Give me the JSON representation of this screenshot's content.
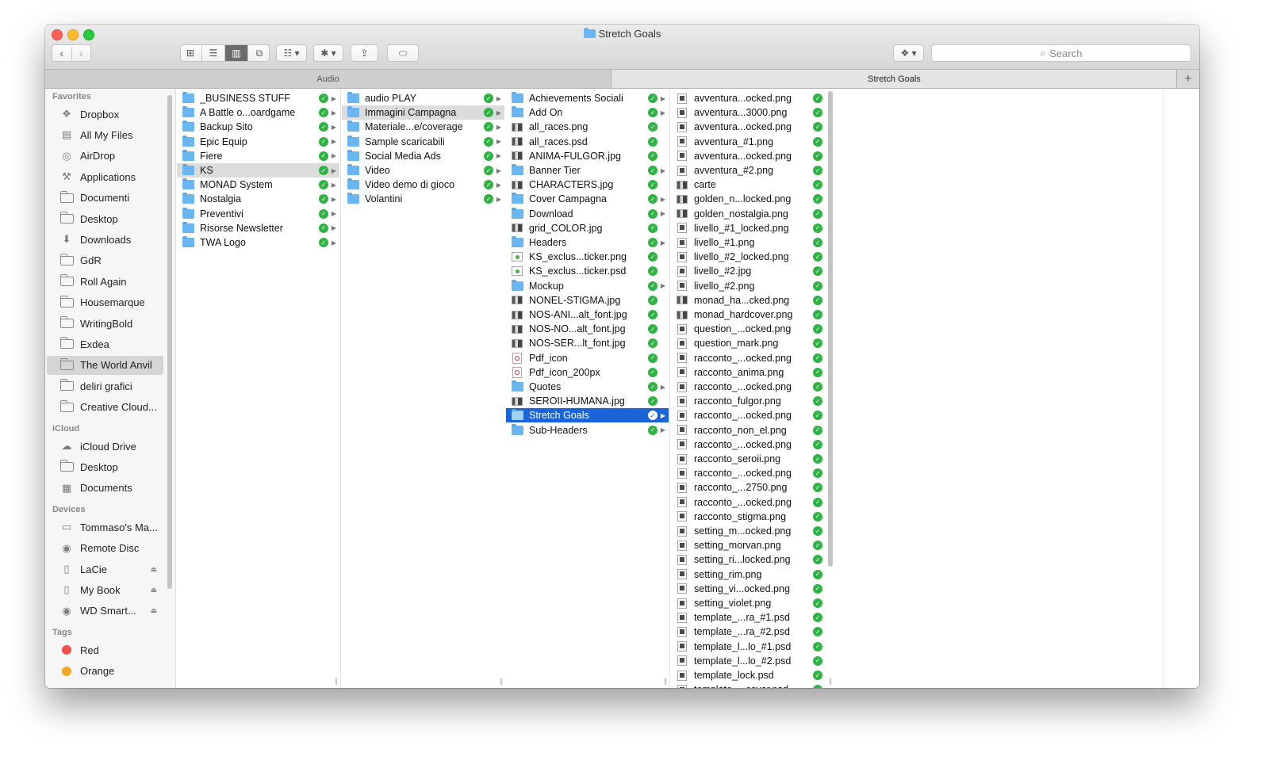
{
  "window": {
    "title": "Stretch Goals"
  },
  "toolbar": {
    "view_icons": [
      "⊞",
      "☰",
      "▥",
      "⧉"
    ],
    "arrange_label": "☷ ▾",
    "action_label": "✱ ▾",
    "share_label": "⇪",
    "tag_label": "⬭",
    "dropbox_label": "❖ ▾",
    "search_placeholder": "Search"
  },
  "tabs": [
    {
      "label": "Audio",
      "active": false
    },
    {
      "label": "Stretch Goals",
      "active": true
    }
  ],
  "sidebar": {
    "favorites_header": "Favorites",
    "favorites": [
      {
        "label": "Dropbox",
        "icon": "dropbox-icon"
      },
      {
        "label": "All My Files",
        "icon": "all-files-icon"
      },
      {
        "label": "AirDrop",
        "icon": "airdrop-icon"
      },
      {
        "label": "Applications",
        "icon": "applications-icon"
      },
      {
        "label": "Documenti",
        "icon": "folder-icon"
      },
      {
        "label": "Desktop",
        "icon": "folder-icon"
      },
      {
        "label": "Downloads",
        "icon": "downloads-icon"
      },
      {
        "label": "GdR",
        "icon": "folder-icon"
      },
      {
        "label": "Roll Again",
        "icon": "folder-icon"
      },
      {
        "label": "Housemarque",
        "icon": "folder-icon"
      },
      {
        "label": "WritingBold",
        "icon": "folder-icon"
      },
      {
        "label": "Exdea",
        "icon": "folder-icon"
      },
      {
        "label": "The World Anvil",
        "icon": "folder-icon",
        "selected": true
      },
      {
        "label": "deliri grafici",
        "icon": "folder-icon"
      },
      {
        "label": "Creative Cloud...",
        "icon": "folder-icon"
      }
    ],
    "icloud_header": "iCloud",
    "icloud": [
      {
        "label": "iCloud Drive",
        "icon": "cloud-icon"
      },
      {
        "label": "Desktop",
        "icon": "folder-icon"
      },
      {
        "label": "Documents",
        "icon": "documents-icon"
      }
    ],
    "devices_header": "Devices",
    "devices": [
      {
        "label": "Tommaso's Ma...",
        "icon": "laptop-icon"
      },
      {
        "label": "Remote Disc",
        "icon": "disc-icon"
      },
      {
        "label": "LaCie",
        "icon": "drive-icon",
        "eject": "⏏"
      },
      {
        "label": "My Book",
        "icon": "drive-icon",
        "eject": "⏏"
      },
      {
        "label": "WD Smart...",
        "icon": "disc-icon",
        "eject": "⏏"
      }
    ],
    "tags_header": "Tags",
    "tags": [
      {
        "label": "Red",
        "color": "#f0504b"
      },
      {
        "label": "Orange",
        "color": "#f5a623"
      }
    ]
  },
  "columns": [
    {
      "items": [
        {
          "name": "_BUSINESS STUFF",
          "type": "folder",
          "arrow": true
        },
        {
          "name": "A Battle o...oardgame",
          "type": "folder",
          "arrow": true
        },
        {
          "name": "Backup Sito",
          "type": "folder",
          "arrow": true
        },
        {
          "name": "Epic Equip",
          "type": "folder",
          "arrow": true
        },
        {
          "name": "Fiere",
          "type": "folder",
          "arrow": true
        },
        {
          "name": "KS",
          "type": "folder",
          "arrow": true,
          "state": "hl"
        },
        {
          "name": "MONAD System",
          "type": "folder",
          "arrow": true
        },
        {
          "name": "Nostalgia",
          "type": "folder",
          "arrow": true
        },
        {
          "name": "Preventivi",
          "type": "folder",
          "arrow": true
        },
        {
          "name": "Risorse Newsletter",
          "type": "folder",
          "arrow": true
        },
        {
          "name": "TWA Logo",
          "type": "folder",
          "arrow": true
        }
      ]
    },
    {
      "items": [
        {
          "name": "audio PLAY",
          "type": "folder",
          "arrow": true
        },
        {
          "name": "Immagini Campagna",
          "type": "folder",
          "arrow": true,
          "state": "hl"
        },
        {
          "name": "Materiale...e/coverage",
          "type": "folder",
          "arrow": true
        },
        {
          "name": "Sample scaricabili",
          "type": "folder",
          "arrow": true
        },
        {
          "name": "Social Media Ads",
          "type": "folder",
          "arrow": true
        },
        {
          "name": "Video",
          "type": "folder",
          "arrow": true
        },
        {
          "name": "Video demo di gioco",
          "type": "folder",
          "arrow": true
        },
        {
          "name": "Volantini",
          "type": "folder",
          "arrow": true
        }
      ]
    },
    {
      "items": [
        {
          "name": "Achievements Sociali",
          "type": "folder",
          "arrow": true
        },
        {
          "name": "Add On",
          "type": "folder",
          "arrow": true
        },
        {
          "name": "all_races.png",
          "type": "img"
        },
        {
          "name": "all_races.psd",
          "type": "img"
        },
        {
          "name": "ANIMA-FULGOR.jpg",
          "type": "img"
        },
        {
          "name": "Banner Tier",
          "type": "folder",
          "arrow": true
        },
        {
          "name": "CHARACTERS.jpg",
          "type": "img"
        },
        {
          "name": "Cover Campagna",
          "type": "folder",
          "arrow": true
        },
        {
          "name": "Download",
          "type": "folder",
          "arrow": true
        },
        {
          "name": "grid_COLOR.jpg",
          "type": "img"
        },
        {
          "name": "Headers",
          "type": "folder",
          "arrow": true
        },
        {
          "name": "KS_exclus...ticker.png",
          "type": "sticker"
        },
        {
          "name": "KS_exclus...ticker.psd",
          "type": "sticker"
        },
        {
          "name": "Mockup",
          "type": "folder",
          "arrow": true
        },
        {
          "name": "NONEL-STIGMA.jpg",
          "type": "img"
        },
        {
          "name": "NOS-ANI...alt_font.jpg",
          "type": "img"
        },
        {
          "name": "NOS-NO...alt_font.jpg",
          "type": "img"
        },
        {
          "name": "NOS-SER...lt_font.jpg",
          "type": "img"
        },
        {
          "name": "Pdf_icon",
          "type": "pdf"
        },
        {
          "name": "Pdf_icon_200px",
          "type": "pdf"
        },
        {
          "name": "Quotes",
          "type": "folder",
          "arrow": true
        },
        {
          "name": "SEROII-HUMANA.jpg",
          "type": "img"
        },
        {
          "name": "Stretch Goals",
          "type": "folder",
          "arrow": true,
          "state": "sel"
        },
        {
          "name": "Sub-Headers",
          "type": "folder",
          "arrow": true
        }
      ]
    },
    {
      "items": [
        {
          "name": "avventura...ocked.png",
          "type": "file"
        },
        {
          "name": "avventura...3000.png",
          "type": "file"
        },
        {
          "name": "avventura...ocked.png",
          "type": "file"
        },
        {
          "name": "avventura_#1.png",
          "type": "file"
        },
        {
          "name": "avventura...ocked.png",
          "type": "file"
        },
        {
          "name": "avventura_#2.png",
          "type": "file"
        },
        {
          "name": "carte",
          "type": "img"
        },
        {
          "name": "golden_n...locked.png",
          "type": "img"
        },
        {
          "name": "golden_nostalgia.png",
          "type": "img"
        },
        {
          "name": "livello_#1_locked.png",
          "type": "file"
        },
        {
          "name": "livello_#1.png",
          "type": "file"
        },
        {
          "name": "livello_#2_locked.png",
          "type": "file"
        },
        {
          "name": "livello_#2.jpg",
          "type": "file"
        },
        {
          "name": "livello_#2.png",
          "type": "file"
        },
        {
          "name": "monad_ha...cked.png",
          "type": "img"
        },
        {
          "name": "monad_hardcover.png",
          "type": "img"
        },
        {
          "name": "question_...ocked.png",
          "type": "file"
        },
        {
          "name": "question_mark.png",
          "type": "file"
        },
        {
          "name": "racconto_...ocked.png",
          "type": "file"
        },
        {
          "name": "racconto_anima.png",
          "type": "file"
        },
        {
          "name": "racconto_...ocked.png",
          "type": "file"
        },
        {
          "name": "racconto_fulgor.png",
          "type": "file"
        },
        {
          "name": "racconto_...ocked.png",
          "type": "file"
        },
        {
          "name": "racconto_non_el.png",
          "type": "file"
        },
        {
          "name": "racconto_...ocked.png",
          "type": "file"
        },
        {
          "name": "racconto_seroii.png",
          "type": "file"
        },
        {
          "name": "racconto_...ocked.png",
          "type": "file"
        },
        {
          "name": "racconto_...2750.png",
          "type": "file"
        },
        {
          "name": "racconto_...ocked.png",
          "type": "file"
        },
        {
          "name": "racconto_stigma.png",
          "type": "file"
        },
        {
          "name": "setting_m...ocked.png",
          "type": "file"
        },
        {
          "name": "setting_morvan.png",
          "type": "file"
        },
        {
          "name": "setting_ri...locked.png",
          "type": "file"
        },
        {
          "name": "setting_rim.png",
          "type": "file"
        },
        {
          "name": "setting_vi...ocked.png",
          "type": "file"
        },
        {
          "name": "setting_violet.png",
          "type": "file"
        },
        {
          "name": "template_...ra_#1.psd",
          "type": "file"
        },
        {
          "name": "template_...ra_#2.psd",
          "type": "file"
        },
        {
          "name": "template_l...lo_#1.psd",
          "type": "file"
        },
        {
          "name": "template_l...lo_#2.psd",
          "type": "file"
        },
        {
          "name": "template_lock.psd",
          "type": "file"
        },
        {
          "name": "template_...cover.psd",
          "type": "file"
        }
      ]
    },
    {
      "items": []
    },
    {
      "items": []
    },
    {
      "items": []
    }
  ],
  "colors": {
    "selection": "#1a63d8",
    "folder": "#6ab6f1",
    "synced": "#2fb345"
  }
}
